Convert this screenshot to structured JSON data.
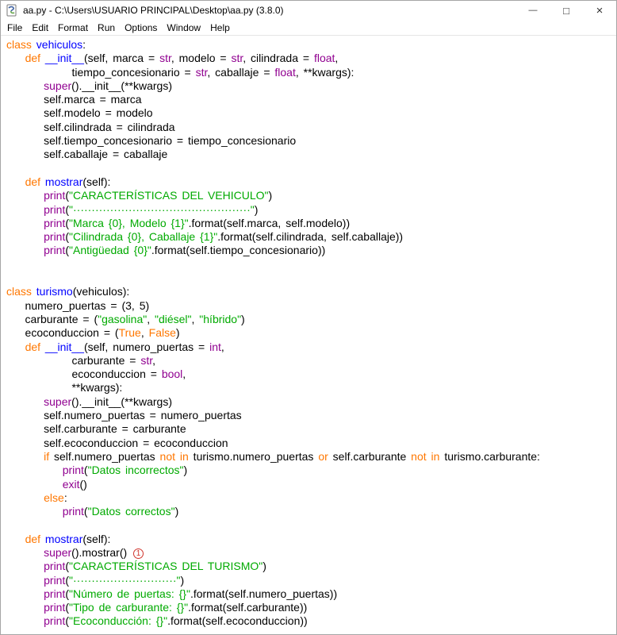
{
  "window": {
    "title": "aa.py - C:\\Users\\USUARIO PRINCIPAL\\Desktop\\aa.py (3.8.0)",
    "controls": {
      "minimize": "—",
      "maximize": "□",
      "close": "×"
    }
  },
  "menu": {
    "items": [
      "File",
      "Edit",
      "Format",
      "Run",
      "Options",
      "Window",
      "Help"
    ]
  },
  "colors": {
    "normal": "#000000",
    "keyword": "#ff7700",
    "builtin": "#900090",
    "def": "#0000ff",
    "string": "#00aa00",
    "annotation": "#d0342c"
  },
  "code": {
    "lines": [
      [
        [
          "k",
          "class"
        ],
        [
          "n",
          " "
        ],
        [
          "d",
          "vehiculos"
        ],
        [
          "n",
          ":"
        ]
      ],
      [
        [
          "n",
          "    "
        ],
        [
          "k",
          "def"
        ],
        [
          "n",
          " "
        ],
        [
          "d",
          "__init__"
        ],
        [
          "n",
          "(self, marca = "
        ],
        [
          "b",
          "str"
        ],
        [
          "n",
          ", modelo = "
        ],
        [
          "b",
          "str"
        ],
        [
          "n",
          ", cilindrada = "
        ],
        [
          "b",
          "float"
        ],
        [
          "n",
          ","
        ]
      ],
      [
        [
          "n",
          "              tiempo_concesionario = "
        ],
        [
          "b",
          "str"
        ],
        [
          "n",
          ", caballaje = "
        ],
        [
          "b",
          "float"
        ],
        [
          "n",
          ", **kwargs):"
        ]
      ],
      [
        [
          "n",
          "        "
        ],
        [
          "b",
          "super"
        ],
        [
          "n",
          "().__init__(**kwargs)"
        ]
      ],
      [
        [
          "n",
          "        self.marca = marca"
        ]
      ],
      [
        [
          "n",
          "        self.modelo = modelo"
        ]
      ],
      [
        [
          "n",
          "        self.cilindrada = cilindrada"
        ]
      ],
      [
        [
          "n",
          "        self.tiempo_concesionario = tiempo_concesionario"
        ]
      ],
      [
        [
          "n",
          "        self.caballaje = caballaje"
        ]
      ],
      [],
      [
        [
          "n",
          "    "
        ],
        [
          "k",
          "def"
        ],
        [
          "n",
          " "
        ],
        [
          "d",
          "mostrar"
        ],
        [
          "n",
          "(self):"
        ]
      ],
      [
        [
          "n",
          "        "
        ],
        [
          "b",
          "print"
        ],
        [
          "n",
          "("
        ],
        [
          "s",
          "\"CARACTERÍSTICAS DEL VEHICULO\""
        ],
        [
          "n",
          ")"
        ]
      ],
      [
        [
          "n",
          "        "
        ],
        [
          "b",
          "print"
        ],
        [
          "n",
          "("
        ],
        [
          "s",
          "\"················································\""
        ],
        [
          "n",
          ")"
        ]
      ],
      [
        [
          "n",
          "        "
        ],
        [
          "b",
          "print"
        ],
        [
          "n",
          "("
        ],
        [
          "s",
          "\"Marca {0}, Modelo {1}\""
        ],
        [
          "n",
          ".format(self.marca, self.modelo))"
        ]
      ],
      [
        [
          "n",
          "        "
        ],
        [
          "b",
          "print"
        ],
        [
          "n",
          "("
        ],
        [
          "s",
          "\"Cilindrada {0}, Caballaje {1}\""
        ],
        [
          "n",
          ".format(self.cilindrada, self.caballaje))"
        ]
      ],
      [
        [
          "n",
          "        "
        ],
        [
          "b",
          "print"
        ],
        [
          "n",
          "("
        ],
        [
          "s",
          "\"Antigüedad {0}\""
        ],
        [
          "n",
          ".format(self.tiempo_concesionario))"
        ]
      ],
      [],
      [],
      [
        [
          "k",
          "class"
        ],
        [
          "n",
          " "
        ],
        [
          "d",
          "turismo"
        ],
        [
          "n",
          "(vehiculos):"
        ]
      ],
      [
        [
          "n",
          "    numero_puertas = (3, 5)"
        ]
      ],
      [
        [
          "n",
          "    carburante = ("
        ],
        [
          "s",
          "\"gasolina\""
        ],
        [
          "n",
          ", "
        ],
        [
          "s",
          "\"diésel\""
        ],
        [
          "n",
          ", "
        ],
        [
          "s",
          "\"híbrido\""
        ],
        [
          "n",
          ")"
        ]
      ],
      [
        [
          "n",
          "    ecoconduccion = ("
        ],
        [
          "k",
          "True"
        ],
        [
          "n",
          ", "
        ],
        [
          "k",
          "False"
        ],
        [
          "n",
          ")"
        ]
      ],
      [
        [
          "n",
          "    "
        ],
        [
          "k",
          "def"
        ],
        [
          "n",
          " "
        ],
        [
          "d",
          "__init__"
        ],
        [
          "n",
          "(self, numero_puertas = "
        ],
        [
          "b",
          "int"
        ],
        [
          "n",
          ","
        ]
      ],
      [
        [
          "n",
          "              carburante = "
        ],
        [
          "b",
          "str"
        ],
        [
          "n",
          ","
        ]
      ],
      [
        [
          "n",
          "              ecoconduccion = "
        ],
        [
          "b",
          "bool"
        ],
        [
          "n",
          ","
        ]
      ],
      [
        [
          "n",
          "              **kwargs):"
        ]
      ],
      [
        [
          "n",
          "        "
        ],
        [
          "b",
          "super"
        ],
        [
          "n",
          "().__init__(**kwargs)"
        ]
      ],
      [
        [
          "n",
          "        self.numero_puertas = numero_puertas"
        ]
      ],
      [
        [
          "n",
          "        self.carburante = carburante"
        ]
      ],
      [
        [
          "n",
          "        self.ecoconduccion = ecoconduccion"
        ]
      ],
      [
        [
          "n",
          "        "
        ],
        [
          "k",
          "if"
        ],
        [
          "n",
          " self.numero_puertas "
        ],
        [
          "k",
          "not"
        ],
        [
          "n",
          " "
        ],
        [
          "k",
          "in"
        ],
        [
          "n",
          " turismo.numero_puertas "
        ],
        [
          "k",
          "or"
        ],
        [
          "n",
          " self.carburante "
        ],
        [
          "k",
          "not"
        ],
        [
          "n",
          " "
        ],
        [
          "k",
          "in"
        ],
        [
          "n",
          " turismo.carburante:"
        ]
      ],
      [
        [
          "n",
          "            "
        ],
        [
          "b",
          "print"
        ],
        [
          "n",
          "("
        ],
        [
          "s",
          "\"Datos incorrectos\""
        ],
        [
          "n",
          ")"
        ]
      ],
      [
        [
          "n",
          "            "
        ],
        [
          "b",
          "exit"
        ],
        [
          "n",
          "()"
        ]
      ],
      [
        [
          "n",
          "        "
        ],
        [
          "k",
          "else"
        ],
        [
          "n",
          ":"
        ]
      ],
      [
        [
          "n",
          "            "
        ],
        [
          "b",
          "print"
        ],
        [
          "n",
          "("
        ],
        [
          "s",
          "\"Datos correctos\""
        ],
        [
          "n",
          ")"
        ]
      ],
      [],
      [
        [
          "n",
          "    "
        ],
        [
          "k",
          "def"
        ],
        [
          "n",
          " "
        ],
        [
          "d",
          "mostrar"
        ],
        [
          "n",
          "(self):"
        ]
      ],
      [
        [
          "n",
          "        "
        ],
        [
          "b",
          "super"
        ],
        [
          "n",
          "().mostrar() "
        ],
        [
          "a",
          "1"
        ]
      ],
      [
        [
          "n",
          "        "
        ],
        [
          "b",
          "print"
        ],
        [
          "n",
          "("
        ],
        [
          "s",
          "\"CARACTERÍSTICAS DEL TURISMO\""
        ],
        [
          "n",
          ")"
        ]
      ],
      [
        [
          "n",
          "        "
        ],
        [
          "b",
          "print"
        ],
        [
          "n",
          "("
        ],
        [
          "s",
          "\"····························\""
        ],
        [
          "n",
          ")"
        ]
      ],
      [
        [
          "n",
          "        "
        ],
        [
          "b",
          "print"
        ],
        [
          "n",
          "("
        ],
        [
          "s",
          "\"Número de puertas: {}\""
        ],
        [
          "n",
          ".format(self.numero_puertas))"
        ]
      ],
      [
        [
          "n",
          "        "
        ],
        [
          "b",
          "print"
        ],
        [
          "n",
          "("
        ],
        [
          "s",
          "\"Tipo de carburante: {}\""
        ],
        [
          "n",
          ".format(self.carburante))"
        ]
      ],
      [
        [
          "n",
          "        "
        ],
        [
          "b",
          "print"
        ],
        [
          "n",
          "("
        ],
        [
          "s",
          "\"Ecoconducción: {}\""
        ],
        [
          "n",
          ".format(self.ecoconduccion))"
        ]
      ]
    ]
  }
}
